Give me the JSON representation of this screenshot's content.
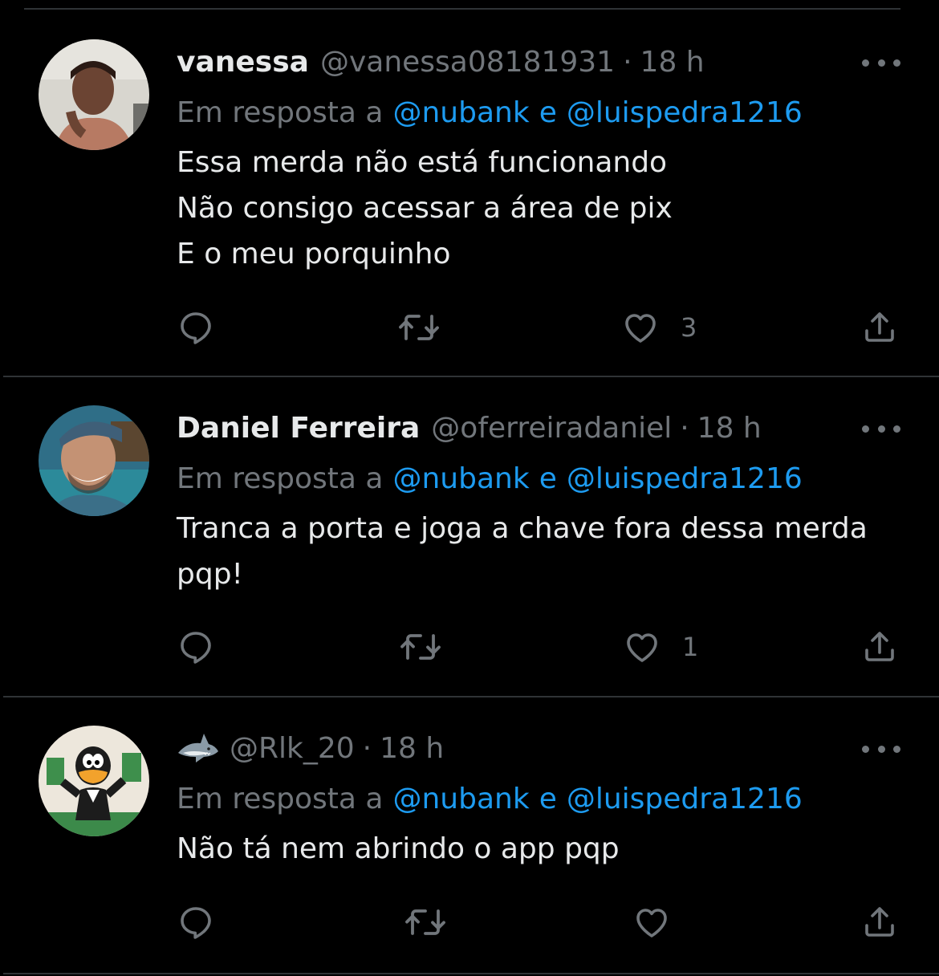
{
  "colors": {
    "background": "#000000",
    "text_primary": "#e7e9ea",
    "text_secondary": "#71767b",
    "accent_link": "#1d9bf0",
    "divider": "#2f3336"
  },
  "reply_prefix": "Em resposta a",
  "tweets": [
    {
      "display_name": "vanessa",
      "handle": "@vanessa08181931",
      "separator": "·",
      "time": "18 h",
      "mentions": [
        "@nubank",
        "@luispedra1216"
      ],
      "conjunction": "e",
      "lines": [
        "Essa merda não está funcionando",
        "Não consigo acessar a área de pix",
        "E o meu porquinho"
      ],
      "likes": "3"
    },
    {
      "display_name": "Daniel Ferreira",
      "handle": "@oferreiradaniel",
      "separator": "·",
      "time": "18 h",
      "mentions": [
        "@nubank",
        "@luispedra1216"
      ],
      "conjunction": "e",
      "lines": [
        "Tranca a porta e joga a chave fora dessa merda",
        "pqp!"
      ],
      "likes": "1"
    },
    {
      "display_name": "",
      "name_icon": "shark-emoji",
      "handle": "@Rlk_20",
      "separator": "·",
      "time": "18 h",
      "mentions": [
        "@nubank",
        "@luispedra1216"
      ],
      "conjunction": "e",
      "lines": [
        "Não tá nem abrindo o app pqp"
      ],
      "likes": ""
    }
  ],
  "icons": {
    "reply": "reply-icon",
    "retweet": "retweet-icon",
    "like": "heart-icon",
    "share": "share-icon",
    "more": "more-icon"
  }
}
